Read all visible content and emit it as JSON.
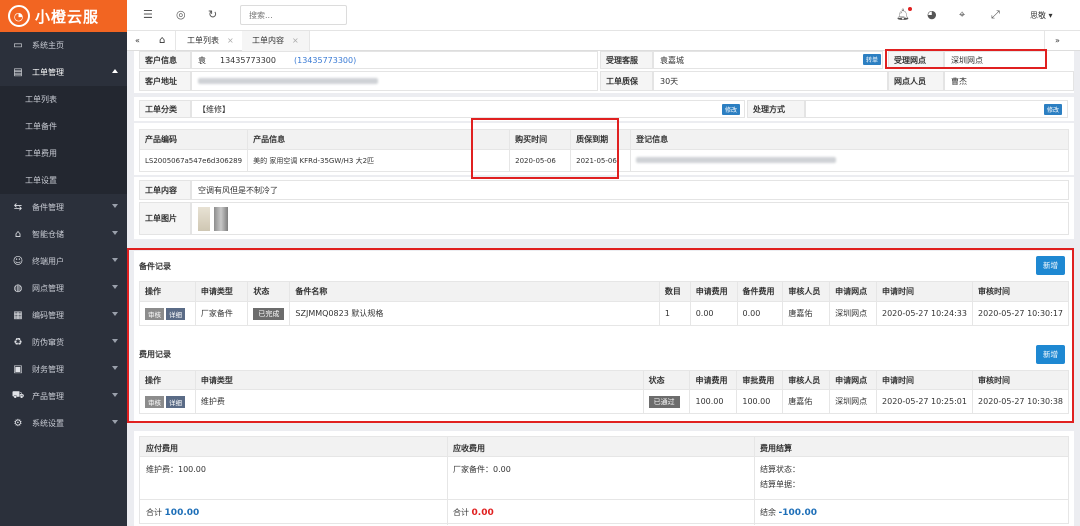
{
  "sidebar": {
    "logo": "小橙云服",
    "items": [
      {
        "label": "系统主页",
        "icon": "monitor-icon"
      },
      {
        "label": "工单管理",
        "icon": "document-icon"
      },
      {
        "label": "备件管理",
        "icon": "arrows-icon"
      },
      {
        "label": "智能仓储",
        "icon": "bank-icon"
      },
      {
        "label": "终端用户",
        "icon": "user-icon"
      },
      {
        "label": "网点管理",
        "icon": "globe-icon"
      },
      {
        "label": "编码管理",
        "icon": "grid-icon"
      },
      {
        "label": "防伪窜货",
        "icon": "recycle-icon"
      },
      {
        "label": "财务管理",
        "icon": "money-icon"
      },
      {
        "label": "产品管理",
        "icon": "cart-icon"
      },
      {
        "label": "系统设置",
        "icon": "gear-icon"
      }
    ],
    "subitems": [
      "工单列表",
      "工单备件",
      "工单费用",
      "工单设置"
    ]
  },
  "topbar": {
    "search_placeholder": "搜索...",
    "user": "思敬"
  },
  "tabs": [
    "工单列表",
    "工单内容"
  ],
  "info": {
    "customer_label": "客户信息",
    "customer_name": "袁",
    "customer_phone": "13435773300",
    "customer_phone_link": "(13435773300)",
    "agent_label": "受理客服",
    "agent": "袁嘉城",
    "transfer_btn": "转单",
    "branch_label": "受理网点",
    "branch": "深圳网点",
    "address_label": "客户地址",
    "warranty_label": "工单质保",
    "warranty": "30天",
    "staff_label": "网点人员",
    "staff": "曹杰",
    "type_label": "工单分类",
    "type": "【维修】",
    "edit_btn": "修改",
    "method_label": "处理方式"
  },
  "product": {
    "headers": [
      "产品编码",
      "产品信息",
      "购买时间",
      "质保到期",
      "登记信息"
    ],
    "row": [
      "LS2005067a547e6d306289",
      "美的 家用空调 KFRd-35GW/H3 大2匹",
      "2020-05-06",
      "2021-05-06"
    ]
  },
  "order": {
    "content_label": "工单内容",
    "content": "空调有风但是不制冷了",
    "images_label": "工单图片"
  },
  "parts": {
    "title": "备件记录",
    "new_btn": "新增",
    "headers": [
      "操作",
      "申请类型",
      "状态",
      "备件名称",
      "数目",
      "申请费用",
      "备件费用",
      "审核人员",
      "申请网点",
      "申请时间",
      "审核时间"
    ],
    "row": {
      "op1": "审核",
      "op2": "详细",
      "type": "厂家备件",
      "status": "已完成",
      "name": "SZJMMQ0823 默认规格",
      "qty": "1",
      "fee": "0.00",
      "part_fee": "0.00",
      "reviewer": "唐嘉佑",
      "branch": "深圳网点",
      "apply_time": "2020-05-27 10:24:33",
      "review_time": "2020-05-27 10:30:17"
    }
  },
  "fees": {
    "title": "费用记录",
    "new_btn": "新增",
    "headers": [
      "操作",
      "申请类型",
      "状态",
      "申请费用",
      "审批费用",
      "审核人员",
      "申请网点",
      "申请时间",
      "审核时间"
    ],
    "row": {
      "op1": "审核",
      "op2": "详细",
      "type": "维护费",
      "status": "已通过",
      "fee": "100.00",
      "approved": "100.00",
      "reviewer": "唐嘉佑",
      "branch": "深圳网点",
      "apply_time": "2020-05-27 10:25:01",
      "review_time": "2020-05-27 10:30:38"
    }
  },
  "summary": {
    "payable_label": "应付费用",
    "receivable_label": "应收费用",
    "settle_label": "费用结算",
    "payable_item": "维护费：100.00",
    "receivable_item": "厂家备件：0.00",
    "settle_status": "结算状态：",
    "settle_doc": "结算单据：",
    "total_label": "合计",
    "total_payable": "100.00",
    "total_receivable": "0.00",
    "balance_label": "结余",
    "balance": "-100.00"
  },
  "colors": {
    "brand": "#f26522",
    "sidebar": "#2b303b",
    "highlight": "#e02020",
    "primary": "#1e88d2"
  }
}
